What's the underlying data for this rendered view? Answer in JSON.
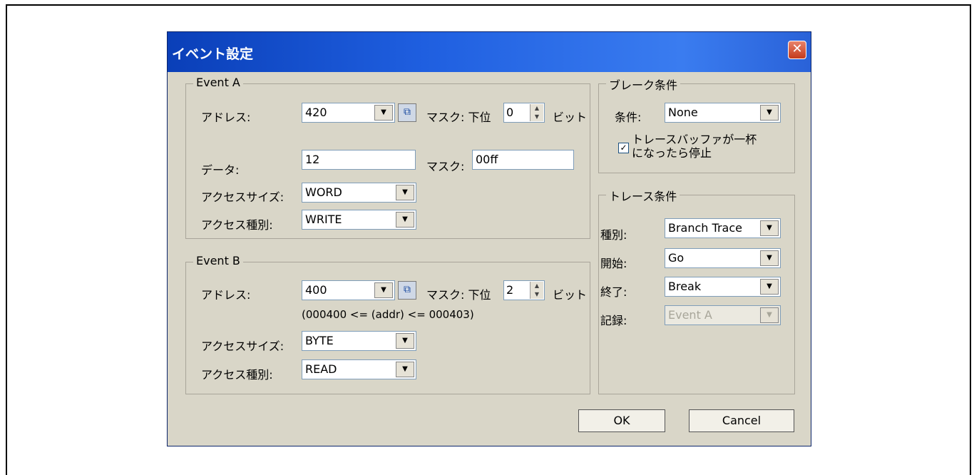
{
  "dialog": {
    "title": "イベント設定",
    "close_glyph": "✕"
  },
  "event_a": {
    "legend": "Event A",
    "address_label": "アドレス:",
    "address_value": "420",
    "mask_label": "マスク: 下位",
    "mask_bits": "0",
    "bits_label": "ビット",
    "data_label": "データ:",
    "data_value": "12",
    "data_mask_label": "マスク:",
    "data_mask_value": "00ff",
    "access_size_label": "アクセスサイズ:",
    "access_size_value": "WORD",
    "access_type_label": "アクセス種別:",
    "access_type_value": "WRITE"
  },
  "event_b": {
    "legend": "Event B",
    "address_label": "アドレス:",
    "address_value": "400",
    "mask_label": "マスク: 下位",
    "mask_bits": "2",
    "bits_label": "ビット",
    "range_text": "(000400 <= (addr) <= 000403)",
    "access_size_label": "アクセスサイズ:",
    "access_size_value": "BYTE",
    "access_type_label": "アクセス種別:",
    "access_type_value": "READ"
  },
  "break_cond": {
    "legend": "ブレーク条件",
    "cond_label": "条件:",
    "cond_value": "None",
    "stop_checkbox_line1": "トレースバッファが一杯",
    "stop_checkbox_line2": "になったら停止",
    "stop_checked": true
  },
  "trace_cond": {
    "legend": "トレース条件",
    "type_label": "種別:",
    "type_value": "Branch Trace",
    "start_label": "開始:",
    "start_value": "Go",
    "end_label": "終了:",
    "end_value": "Break",
    "record_label": "記録:",
    "record_value": "Event A"
  },
  "buttons": {
    "ok": "OK",
    "cancel": "Cancel"
  },
  "icons": {
    "dropdown_arrow": "▼",
    "spin_up": "▲",
    "spin_down": "▼",
    "check": "✓",
    "browse": "⧉"
  }
}
